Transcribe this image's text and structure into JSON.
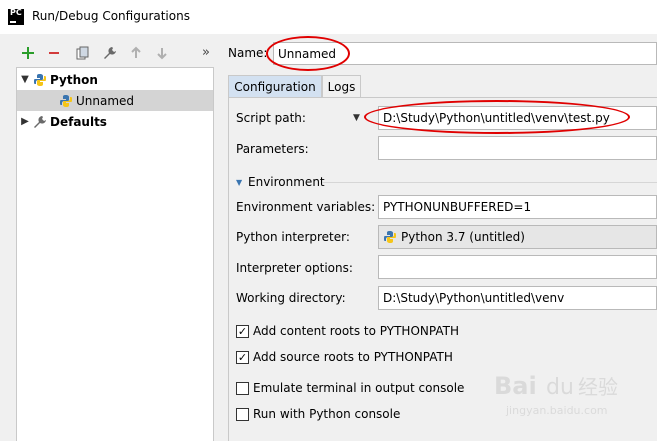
{
  "window": {
    "title": "Run/Debug Configurations",
    "app_icon_text": "PC"
  },
  "toolbar": {
    "buttons": [
      "add-icon",
      "remove-icon",
      "copy-icon",
      "wrench-icon",
      "move-up-icon",
      "move-down-icon"
    ],
    "overflow": "»"
  },
  "tree": {
    "items": [
      {
        "label": "Python",
        "expanded": true,
        "icon": "python-icon"
      },
      {
        "label": "Unnamed",
        "icon": "python-icon",
        "selected": true
      },
      {
        "label": "Defaults",
        "expanded": false,
        "icon": "wrench-icon"
      }
    ]
  },
  "name_field": {
    "label": "Name:",
    "value": "Unnamed"
  },
  "tabs": [
    {
      "label": "Configuration",
      "active": true
    },
    {
      "label": "Logs",
      "active": false
    }
  ],
  "config": {
    "script_path": {
      "label": "Script path:",
      "value": "D:\\Study\\Python\\untitled\\venv\\test.py"
    },
    "parameters": {
      "label": "Parameters:",
      "value": ""
    },
    "environment": {
      "section_label": "Environment",
      "env_vars": {
        "label": "Environment variables:",
        "value": "PYTHONUNBUFFERED=1"
      },
      "interpreter": {
        "label": "Python interpreter:",
        "value": "Python 3.7 (untitled)"
      },
      "interpreter_options": {
        "label": "Interpreter options:",
        "value": ""
      },
      "working_dir": {
        "label": "Working directory:",
        "value": "D:\\Study\\Python\\untitled\\venv"
      }
    },
    "checkboxes": [
      {
        "label": "Add content roots to PYTHONPATH",
        "checked": true
      },
      {
        "label": "Add source roots to PYTHONPATH",
        "checked": true
      },
      {
        "label": "Emulate terminal in output console",
        "checked": false
      },
      {
        "label": "Run with Python console",
        "checked": false
      }
    ]
  },
  "watermark": {
    "text": "Baidu经验",
    "sub": "jingyan.baidu.com"
  },
  "colors": {
    "accent_tab": "#d3e1f1",
    "selection": "#d4d4d4",
    "annotation": "#e00000",
    "add": "#2a9d2a",
    "remove": "#d23b3b"
  }
}
